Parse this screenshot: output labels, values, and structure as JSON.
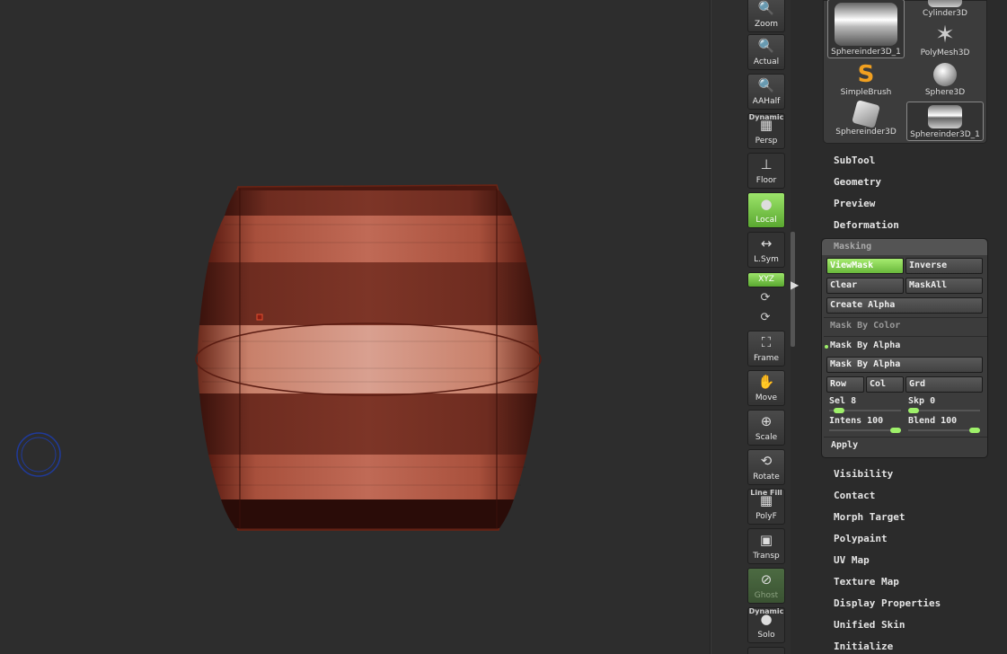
{
  "shelf": {
    "buttons": [
      {
        "label": "Zoom",
        "icon": "zoom-icon"
      },
      {
        "label": "Actual",
        "icon": "actual-icon"
      },
      {
        "label": "AAHalf",
        "icon": "aahalf-icon"
      },
      {
        "label": "Persp",
        "top_label": "Dynamic",
        "icon": "perspective-icon"
      },
      {
        "label": "Floor",
        "icon": "floor-icon"
      },
      {
        "label": "Local",
        "icon": "local-icon"
      },
      {
        "label": "L.Sym",
        "icon": "lsym-icon"
      },
      {
        "label": "Frame",
        "icon": "frame-icon"
      },
      {
        "label": "Move",
        "icon": "move-icon"
      },
      {
        "label": "Scale",
        "icon": "scale-icon"
      },
      {
        "label": "Rotate",
        "icon": "rotate-icon"
      },
      {
        "label": "PolyF",
        "top_label": "Line Fill",
        "icon": "polyframe-icon"
      },
      {
        "label": "Transp",
        "icon": "transparency-icon"
      },
      {
        "label": "Ghost",
        "icon": "ghost-icon"
      },
      {
        "label": "Solo",
        "top_label": "Dynamic",
        "icon": "solo-icon"
      }
    ],
    "xyz_label": "XYZ"
  },
  "tools": [
    {
      "label": "Sphereinder3D_1"
    },
    {
      "label": "Cylinder3D"
    },
    {
      "label": "PolyMesh3D"
    },
    {
      "label": "SimpleBrush"
    },
    {
      "label": "Sphere3D"
    },
    {
      "label": "Sphereinder3D"
    },
    {
      "label": "Sphereinder3D_1"
    }
  ],
  "menu_top": [
    "SubTool",
    "Geometry",
    "Preview",
    "Deformation"
  ],
  "masking": {
    "title": "Masking",
    "viewmask": "ViewMask",
    "inverse": "Inverse",
    "clear": "Clear",
    "maskall": "MaskAll",
    "create_alpha": "Create Alpha",
    "mask_by_color": "Mask By Color",
    "mask_by_alpha_label": "Mask By Alpha",
    "mask_by_alpha_btn": "Mask By Alpha",
    "row": "Row",
    "col": "Col",
    "grd": "Grd",
    "sel": "Sel 8",
    "skp": "Skp 0",
    "intens": "Intens 100",
    "blend": "Blend 100",
    "apply": "Apply",
    "sel_level": 0.08,
    "skp_level": 0.0,
    "intens_level": 1.0,
    "blend_level": 1.0
  },
  "menu_bottom": [
    "Visibility",
    "Contact",
    "Morph Target",
    "Polypaint",
    "UV Map",
    "Texture Map",
    "Display Properties",
    "Unified Skin",
    "Initialize"
  ],
  "colors": {
    "accent_green": "#9ef06a",
    "model_red": "#a84a38",
    "background": "#2d2d2d"
  }
}
